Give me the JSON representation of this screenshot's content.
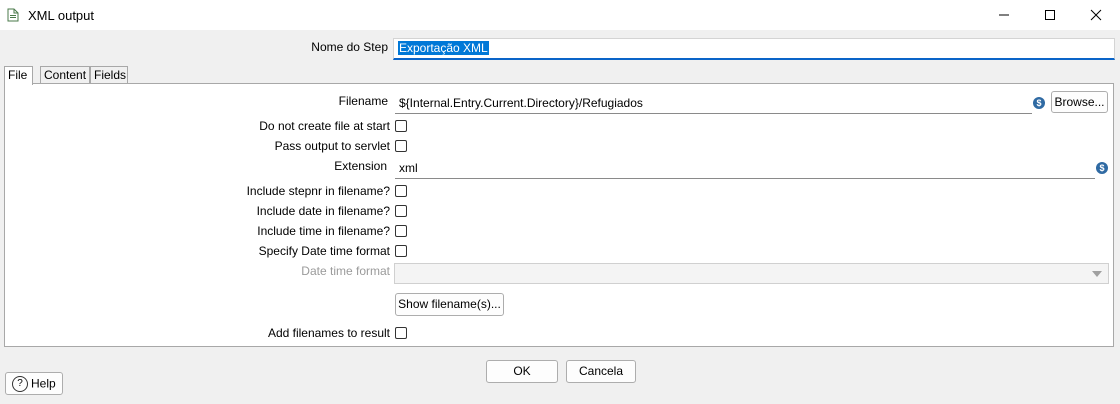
{
  "window": {
    "title": "XML output",
    "icons": {
      "app": "document-icon",
      "minimize": "minimize-icon",
      "maximize": "maximize-icon",
      "close": "close-icon"
    }
  },
  "step": {
    "label": "Nome do Step",
    "value": "Exportação XML"
  },
  "tabs": [
    {
      "label": "File",
      "active": true
    },
    {
      "label": "Content",
      "active": false
    },
    {
      "label": "Fields",
      "active": false
    }
  ],
  "file_tab": {
    "filename_label": "Filename",
    "filename_value": "${Internal.Entry.Current.Directory}/Refugiados",
    "browse_label": "Browse...",
    "do_not_create_label": "Do not create file at start",
    "pass_output_label": "Pass output to servlet",
    "extension_label": "Extension",
    "extension_value": "xml",
    "include_stepnr_label": "Include stepnr in filename?",
    "include_date_label": "Include date in filename?",
    "include_time_label": "Include time in filename?",
    "specify_date_format_label": "Specify Date time format",
    "date_time_format_label": "Date time format",
    "date_time_format_value": "",
    "show_filenames_label": "Show filename(s)...",
    "add_filenames_label": "Add filenames to result",
    "checkboxes": {
      "do_not_create": false,
      "pass_output": false,
      "include_stepnr": false,
      "include_date": false,
      "include_time": false,
      "specify_date_format": false,
      "add_filenames": false
    }
  },
  "footer": {
    "ok_label": "OK",
    "cancel_label": "Cancela",
    "help_label": "Help"
  },
  "colors": {
    "accent": "#0078d7",
    "variable_icon": "#2f6aa3"
  }
}
